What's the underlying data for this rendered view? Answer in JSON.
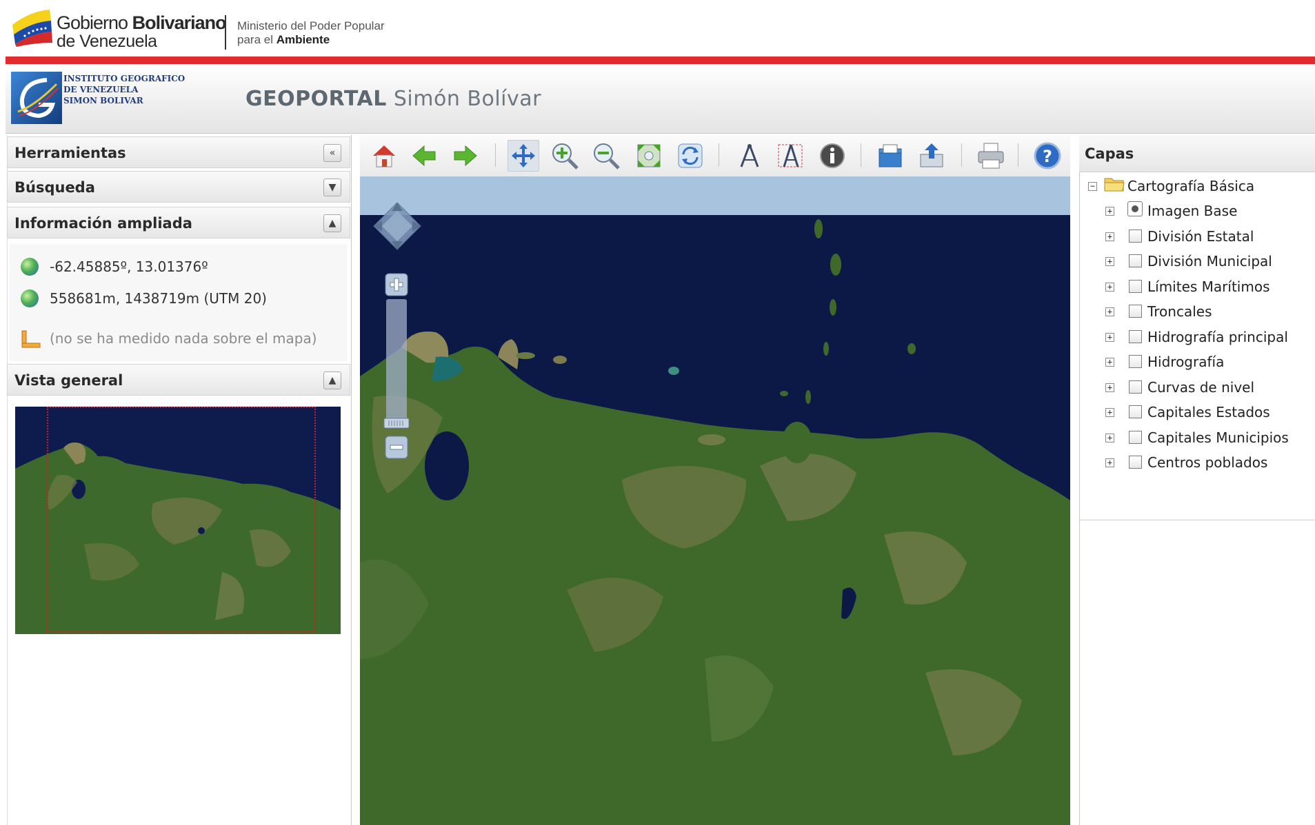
{
  "gov_header": {
    "title_line1_a": "Gobierno ",
    "title_line1_b": "Bolivariano",
    "title_line2": "de Venezuela",
    "ministry_line1": "Ministerio del Poder Popular",
    "ministry_line2_a": "para el ",
    "ministry_line2_b": "Ambiente",
    "accent_color": "#e12b2f"
  },
  "banner": {
    "institute_lines": [
      "INSTITUTO GEOGRAFICO",
      "DE VENEZUELA",
      "SIMON BOLIVAR"
    ],
    "title_bold": "GEOPORTAL",
    "title_light": "Simón Bolívar"
  },
  "left_panel": {
    "sections": [
      {
        "title": "Herramientas",
        "button_icon": "collapse-left-icon",
        "glyph": "«"
      },
      {
        "title": "Búsqueda",
        "button_icon": "chevron-down-icon",
        "glyph": "▼"
      },
      {
        "title": "Información ampliada",
        "button_icon": "chevron-up-icon",
        "glyph": "▲"
      },
      {
        "title": "Vista general",
        "button_icon": "chevron-up-icon",
        "glyph": "▲"
      }
    ],
    "info": {
      "geo_coords": "-62.45885º, 13.01376º",
      "utm_coords": "558681m, 1438719m (UTM 20)",
      "measure_text": "(no se ha medido nada sobre el mapa)"
    }
  },
  "toolbar": {
    "tools": [
      {
        "name": "home-icon"
      },
      {
        "name": "back-arrow-icon"
      },
      {
        "name": "forward-arrow-icon"
      },
      {
        "name": "pan-icon",
        "active": true
      },
      {
        "name": "zoom-in-icon"
      },
      {
        "name": "zoom-out-icon"
      },
      {
        "name": "zoom-extent-icon"
      },
      {
        "name": "refresh-icon"
      },
      {
        "name": "measure-distance-icon"
      },
      {
        "name": "measure-area-icon"
      },
      {
        "name": "info-icon"
      },
      {
        "name": "open-folder-icon"
      },
      {
        "name": "export-icon"
      },
      {
        "name": "print-icon"
      },
      {
        "name": "help-icon"
      }
    ]
  },
  "capas": {
    "title": "Capas",
    "root": "Cartografía Básica",
    "layers": [
      {
        "label": "Imagen Base",
        "control": "radio"
      },
      {
        "label": "División Estatal",
        "control": "checkbox"
      },
      {
        "label": "División Municipal",
        "control": "checkbox"
      },
      {
        "label": "Límites Marítimos",
        "control": "checkbox"
      },
      {
        "label": "Troncales",
        "control": "checkbox"
      },
      {
        "label": "Hidrografía principal",
        "control": "checkbox"
      },
      {
        "label": "Hidrografía",
        "control": "checkbox"
      },
      {
        "label": "Curvas de nivel",
        "control": "checkbox"
      },
      {
        "label": "Capitales Estados",
        "control": "checkbox"
      },
      {
        "label": "Capitales Municipios",
        "control": "checkbox"
      },
      {
        "label": "Centros poblados",
        "control": "checkbox"
      }
    ]
  },
  "colors": {
    "sea": "#0d1a4a",
    "land": "#3f6a2c",
    "land_dry": "#8c8a5a",
    "map_strip": "#a8c3de"
  }
}
